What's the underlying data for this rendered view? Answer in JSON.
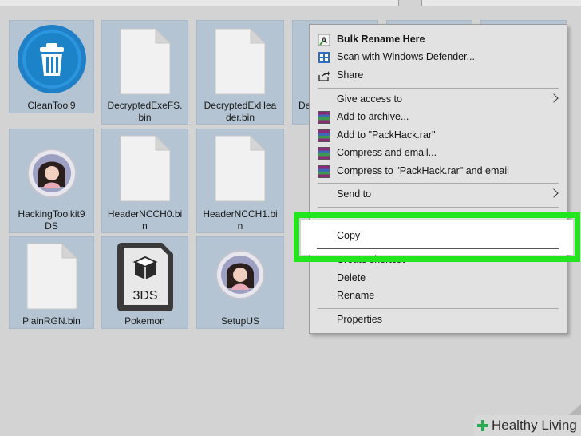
{
  "files": [
    {
      "name": "CleanTool9",
      "icon": "recycle-bin-icon"
    },
    {
      "name": "DecryptedExeFS.\nbin",
      "icon": "blank-file-icon"
    },
    {
      "name": "DecryptedExHea\nder.bin",
      "icon": "blank-file-icon"
    },
    {
      "name": "De",
      "icon": "blank-file-icon"
    },
    {
      "name": "HackingToolkit9\nDS",
      "icon": "anime-avatar-icon"
    },
    {
      "name": "HeaderNCCH0.bi\nn",
      "icon": "blank-file-icon"
    },
    {
      "name": "HeaderNCCH1.bi\nn",
      "icon": "blank-file-icon"
    },
    {
      "name": "PlainRGN.bin",
      "icon": "blank-file-icon"
    },
    {
      "name": "Pokemon",
      "icon": "3ds-file-icon"
    },
    {
      "name": "SetupUS",
      "icon": "anime-avatar-icon"
    }
  ],
  "icon_text": {
    "three_ds": "3DS"
  },
  "context_menu": {
    "bulk_rename": "Bulk Rename Here",
    "scan_defender": "Scan with Windows Defender...",
    "share": "Share",
    "give_access": "Give access to",
    "add_archive": "Add to archive...",
    "add_packhack": "Add to \"PackHack.rar\"",
    "compress_email": "Compress and email...",
    "compress_packhack_email": "Compress to \"PackHack.rar\" and email",
    "send_to": "Send to",
    "copy": "Copy",
    "create_shortcut": "Create shortcut",
    "delete": "Delete",
    "rename": "Rename",
    "properties": "Properties"
  },
  "highlight_color": "#23e51e",
  "watermark": {
    "text": "Healthy Living"
  }
}
